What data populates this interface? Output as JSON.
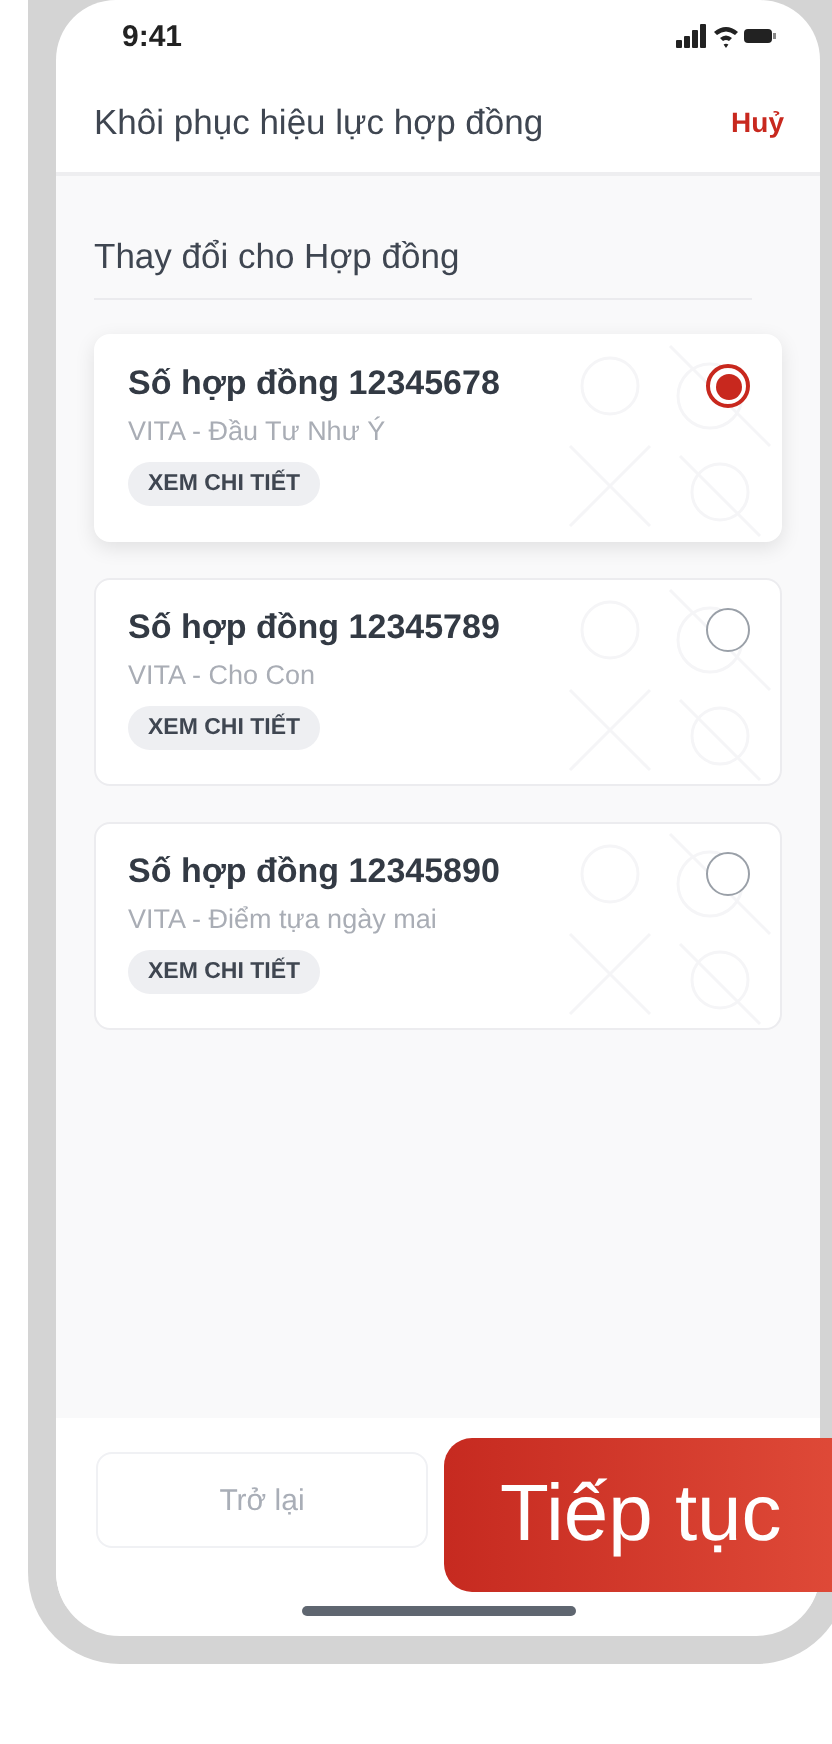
{
  "status_bar": {
    "time": "9:41"
  },
  "header": {
    "title": "Khôi phục hiệu lực hợp đồng",
    "cancel": "Huỷ"
  },
  "section_title": "Thay đổi cho Hợp đồng",
  "contracts": [
    {
      "title": "Số hợp đồng 12345678",
      "product": "VITA - Đầu Tư Như Ý",
      "details": "XEM CHI TIẾT",
      "selected": true
    },
    {
      "title": "Số hợp đồng 12345789",
      "product": "VITA - Cho Con",
      "details": "XEM CHI TIẾT",
      "selected": false
    },
    {
      "title": "Số hợp đồng 12345890",
      "product": "VITA - Điểm tựa ngày mai",
      "details": "XEM CHI TIẾT",
      "selected": false
    }
  ],
  "buttons": {
    "back": {
      "label": "Trở lại",
      "disabled": true
    },
    "next": {
      "label": "Tiếp tục"
    }
  }
}
